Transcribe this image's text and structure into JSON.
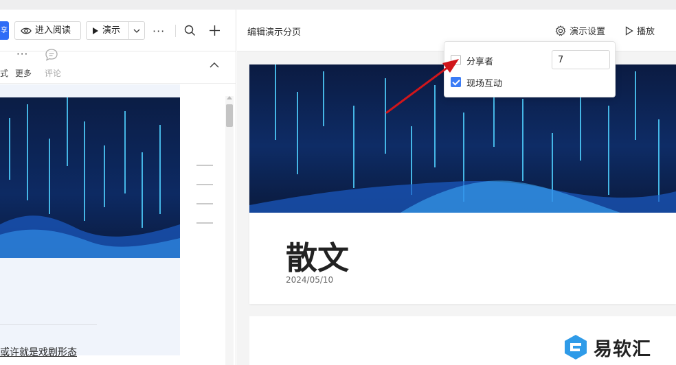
{
  "left_toolbar": {
    "blue_label": "享",
    "read_label": "进入阅读",
    "present_label": "演示",
    "more_label": "···"
  },
  "subbar": {
    "style_label": "式",
    "more_label": "更多",
    "comment_label": "评论"
  },
  "left_doc": {
    "body_text": "或许就是戏剧形态"
  },
  "right_header": {
    "title": "编辑演示分页",
    "settings_label": "演示设置",
    "play_label": "播放"
  },
  "popup": {
    "sharer_label": "分享者",
    "sharer_checked": false,
    "sharer_value": "7",
    "interactive_label": "现场互动",
    "interactive_checked": true
  },
  "slide": {
    "title": "散文",
    "date": "2024/05/10"
  },
  "logo": {
    "text": "易软汇"
  },
  "colors": {
    "accent": "#2f6cf6",
    "checkbox": "#3b7cf6",
    "arrow": "#d0161b",
    "image_dark": "#0a1a3d"
  }
}
